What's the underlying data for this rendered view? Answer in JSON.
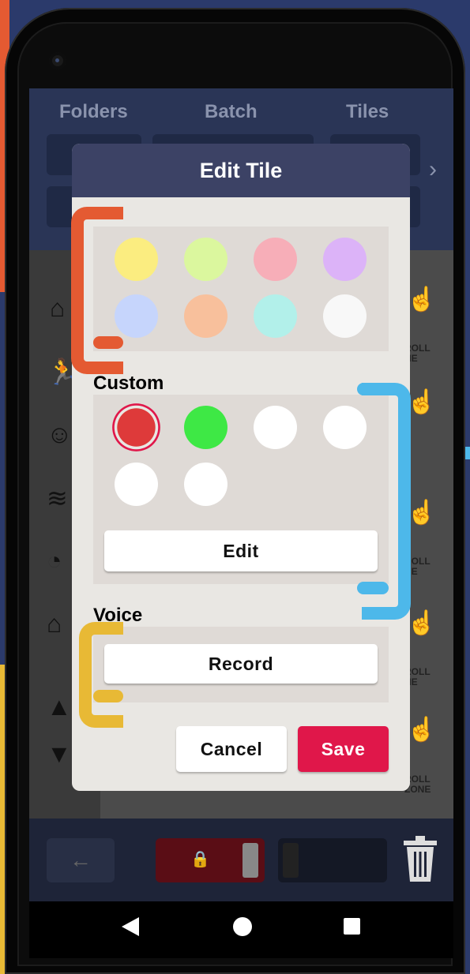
{
  "colors": {
    "orange": "#e45a32",
    "blue": "#4db8ea",
    "yellow": "#e8b935",
    "save": "#e0174a",
    "dialog_header": "#3c4265"
  },
  "app": {
    "tabs": [
      "Folders",
      "Batch",
      "Tiles"
    ],
    "scroll_zone_label": [
      "ROLL",
      "NE"
    ],
    "scroll_zone_label_last": [
      "ROLL",
      "ZONE"
    ]
  },
  "dialog": {
    "title": "Edit Tile",
    "preset_swatches": [
      "#fbed80",
      "#dbf79e",
      "#f7aeb8",
      "#dcb3f8",
      "#c6d5fc",
      "#f8c09c",
      "#b2f0ea",
      "#f8f8f8"
    ],
    "custom": {
      "title": "Custom",
      "swatches": [
        "#de3a3a",
        "#3ee845",
        "#ffffff",
        "#ffffff",
        "#ffffff",
        "#ffffff"
      ],
      "selected_index": 0,
      "edit_label": "Edit"
    },
    "voice": {
      "title": "Voice",
      "record_label": "Record"
    },
    "cancel_label": "Cancel",
    "save_label": "Save"
  },
  "nav": {
    "back_icon": "triangle-back-icon",
    "home_icon": "circle-home-icon",
    "recents_icon": "square-recents-icon"
  }
}
